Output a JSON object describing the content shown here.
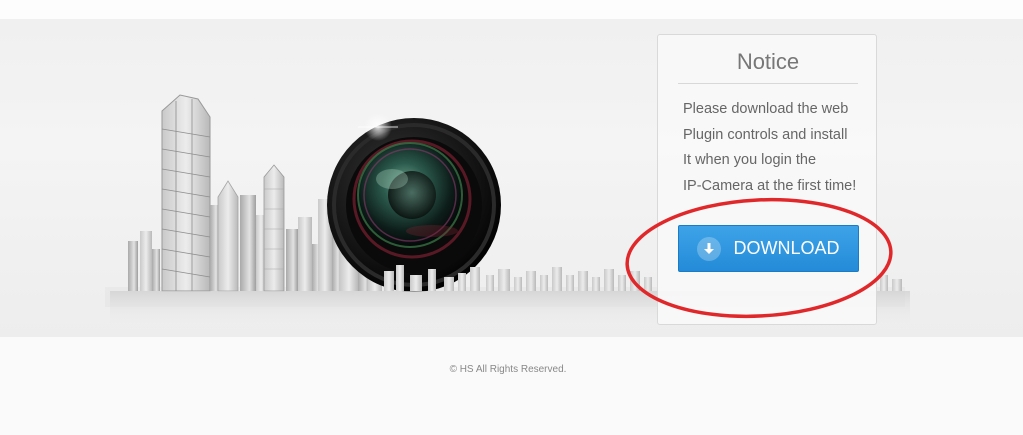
{
  "notice": {
    "title": "Notice",
    "lines": [
      "Please download the web",
      "Plugin controls and install",
      "It when you login the",
      "IP-Camera at the first time!"
    ],
    "download_label": "DOWNLOAD"
  },
  "footer": {
    "copyright": "©  HS  All Rights Reserved."
  },
  "icons": {
    "download": "download-arrow-icon",
    "camera": "camera-lens-icon"
  },
  "colors": {
    "button": "#2e94dd",
    "annotation": "#e0282a"
  }
}
